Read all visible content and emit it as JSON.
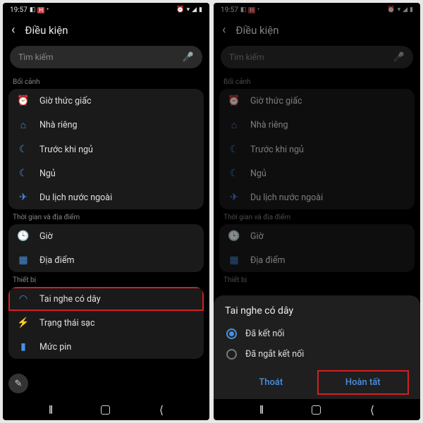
{
  "status": {
    "time": "19:57",
    "red_badge": "H"
  },
  "header": {
    "title": "Điều kiện"
  },
  "search": {
    "placeholder": "Tìm kiếm"
  },
  "sections": {
    "context": {
      "label": "Bối cảnh"
    },
    "timeplace": {
      "label": "Thời gian và địa điểm"
    },
    "device": {
      "label": "Thiết bị"
    }
  },
  "context_items": [
    {
      "icon": "alarm",
      "label": "Giờ thức giấc"
    },
    {
      "icon": "home",
      "label": "Nhà riêng"
    },
    {
      "icon": "moon",
      "label": "Trước khi ngủ"
    },
    {
      "icon": "moon",
      "label": "Ngủ"
    },
    {
      "icon": "plane",
      "label": "Du lịch nước ngoài"
    }
  ],
  "timeplace_items": [
    {
      "icon": "clock",
      "label": "Giờ"
    },
    {
      "icon": "grid",
      "label": "Địa điểm"
    }
  ],
  "device_items": [
    {
      "icon": "headphones",
      "label": "Tai nghe có dây"
    },
    {
      "icon": "bolt",
      "label": "Trạng thái sạc"
    },
    {
      "icon": "battery",
      "label": "Mức pin"
    }
  ],
  "sheet": {
    "title": "Tai nghe có dây",
    "opt_connected": "Đã kết nối",
    "opt_disconnected": "Đã ngắt kết nối",
    "cancel": "Thoát",
    "done": "Hoàn tất"
  },
  "icons": {
    "alarm": "⏰",
    "home": "⌂",
    "moon": "☾",
    "plane": "✈",
    "clock": "🕒",
    "grid": "▦",
    "headphones": "◠",
    "bolt": "⚡",
    "battery": "▮",
    "mic": "🎤",
    "pencil": "✎"
  }
}
